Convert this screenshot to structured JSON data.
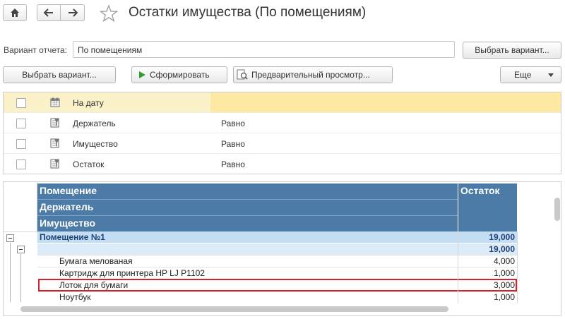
{
  "window": {
    "title": "Остатки имущества (По помещениям)"
  },
  "icons": {
    "home": "home-icon",
    "back": "arrow-left-icon",
    "forward": "arrow-right-icon",
    "favorite": "star-icon",
    "play": "play-icon",
    "preview": "magnifier-icon",
    "dropdown": "chevron-down-icon",
    "calendar": "calendar-icon",
    "filter": "filter-icon"
  },
  "variant": {
    "label": "Вариант отчета:",
    "value": "По помещениям",
    "choose_button": "Выбрать вариант..."
  },
  "toolbar": {
    "choose_variant": "Выбрать вариант...",
    "generate": "Сформировать",
    "preview": "Предварительный просмотр...",
    "more": "Еще"
  },
  "filters": [
    {
      "name": "На дату",
      "condition": "",
      "checked": false,
      "icon": "calendar-icon",
      "selected": true
    },
    {
      "name": "Держатель",
      "condition": "Равно",
      "checked": false,
      "icon": "filter-icon",
      "selected": false
    },
    {
      "name": "Имущество",
      "condition": "Равно",
      "checked": false,
      "icon": "filter-icon",
      "selected": false
    },
    {
      "name": "Остаток",
      "condition": "Равно",
      "checked": false,
      "icon": "filter-icon",
      "selected": false
    }
  ],
  "report": {
    "headers": {
      "room": "Помещение",
      "holder": "Держатель",
      "property": "Имущество",
      "balance": "Остаток"
    },
    "group_room": {
      "label": "Помещение №1",
      "value": "19,000"
    },
    "group_holder": {
      "label": "",
      "value": "19,000"
    },
    "items": [
      {
        "name": "Бумага мелованая",
        "value": "4,000",
        "highlighted": false
      },
      {
        "name": "Картридж для принтера HP LJ P1102",
        "value": "1,000",
        "highlighted": false
      },
      {
        "name": "Лоток для бумаги",
        "value": "3,000",
        "highlighted": true
      },
      {
        "name": "Ноутбук",
        "value": "1,000",
        "highlighted": false
      }
    ]
  },
  "colors": {
    "header_bg": "#4d7ba7",
    "group1_bg": "#c3ddf3",
    "group2_bg": "#dcebf8",
    "selected_row": "#fde9a1",
    "highlight_border": "#d2232a",
    "group_text": "#1f3f77",
    "play_green": "#2e9e2e"
  }
}
